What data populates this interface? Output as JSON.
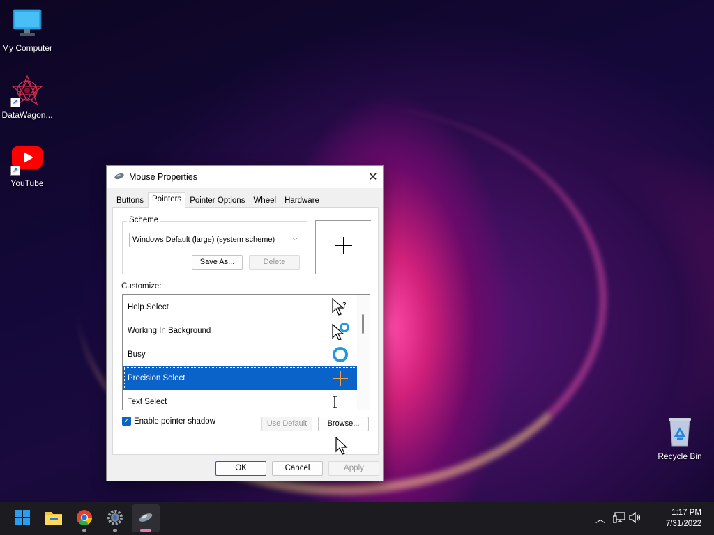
{
  "desktop": {
    "icons": [
      {
        "label": "My Computer",
        "icon": "monitor-icon"
      },
      {
        "label": "DataWagon...",
        "icon": "datawagon-logo-icon"
      },
      {
        "label": "YouTube",
        "icon": "youtube-icon"
      },
      {
        "label": "Recycle Bin",
        "icon": "recycle-bin-icon"
      }
    ]
  },
  "dialog": {
    "title": "Mouse Properties",
    "tabs": [
      "Buttons",
      "Pointers",
      "Pointer Options",
      "Wheel",
      "Hardware"
    ],
    "active_tab": "Pointers",
    "scheme": {
      "legend": "Scheme",
      "selected": "Windows Default (large) (system scheme)",
      "save_as": "Save As...",
      "delete": "Delete"
    },
    "customize_label": "Customize:",
    "cursors": [
      {
        "name": "Help Select",
        "icon": "help-select-cursor-icon"
      },
      {
        "name": "Working In Background",
        "icon": "working-background-cursor-icon"
      },
      {
        "name": "Busy",
        "icon": "busy-cursor-icon"
      },
      {
        "name": "Precision Select",
        "icon": "precision-select-cursor-icon",
        "selected": true
      },
      {
        "name": "Text Select",
        "icon": "text-select-cursor-icon"
      }
    ],
    "shadow": {
      "label": "Enable pointer shadow",
      "checked": true
    },
    "use_default": "Use Default",
    "browse": "Browse...",
    "ok": "OK",
    "cancel": "Cancel",
    "apply": "Apply"
  },
  "taskbar": {
    "apps": [
      "start-icon",
      "file-explorer-icon",
      "chrome-icon",
      "settings-icon",
      "mouse-properties-icon"
    ],
    "time": "1:17 PM",
    "date": "7/31/2022"
  },
  "colors": {
    "accent": "#0a63c9",
    "taskbar": "#1c1c20"
  }
}
